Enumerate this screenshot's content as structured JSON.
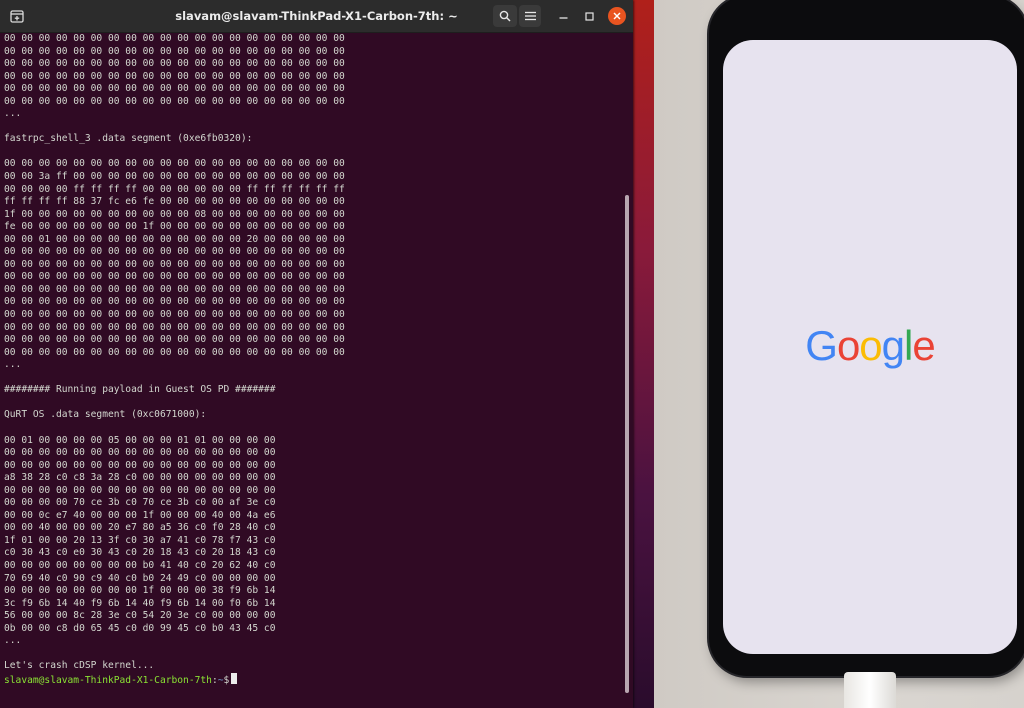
{
  "terminal": {
    "title": "slavam@slavam-ThinkPad-X1-Carbon-7th: ~",
    "lines": [
      "00 00 00 00 00 00 00 00 00 00 00 00 00 00 00 00 00 00 00 00",
      "00 00 00 00 00 00 00 00 00 00 00 00 00 00 00 00 00 00 00 00",
      "00 00 00 00 00 00 00 00 00 00 00 00 00 00 00 00 00 00 00 00",
      "00 00 00 00 00 00 00 00 00 00 00 00 00 00 00 00 00 00 00 00",
      "00 00 00 00 00 00 00 00 00 00 00 00 00 00 00 00 00 00 00 00",
      "00 00 00 00 00 00 00 00 00 00 00 00 00 00 00 00 00 00 00 00",
      "...",
      "",
      "fastrpc_shell_3 .data segment (0xe6fb0320):",
      "",
      "00 00 00 00 00 00 00 00 00 00 00 00 00 00 00 00 00 00 00 00",
      "00 00 3a ff 00 00 00 00 00 00 00 00 00 00 00 00 00 00 00 00",
      "00 00 00 00 ff ff ff ff 00 00 00 00 00 00 ff ff ff ff ff ff",
      "ff ff ff ff 88 37 fc e6 fe 00 00 00 00 00 00 00 00 00 00 00",
      "1f 00 00 00 00 00 00 00 00 00 00 08 00 00 00 00 00 00 00 00",
      "fe 00 00 00 00 00 00 00 1f 00 00 00 00 00 00 00 00 00 00 00",
      "00 00 01 00 00 00 00 00 00 00 00 00 00 00 20 00 00 00 00 00",
      "00 00 00 00 00 00 00 00 00 00 00 00 00 00 00 00 00 00 00 00",
      "00 00 00 00 00 00 00 00 00 00 00 00 00 00 00 00 00 00 00 00",
      "00 00 00 00 00 00 00 00 00 00 00 00 00 00 00 00 00 00 00 00",
      "00 00 00 00 00 00 00 00 00 00 00 00 00 00 00 00 00 00 00 00",
      "00 00 00 00 00 00 00 00 00 00 00 00 00 00 00 00 00 00 00 00",
      "00 00 00 00 00 00 00 00 00 00 00 00 00 00 00 00 00 00 00 00",
      "00 00 00 00 00 00 00 00 00 00 00 00 00 00 00 00 00 00 00 00",
      "00 00 00 00 00 00 00 00 00 00 00 00 00 00 00 00 00 00 00 00",
      "00 00 00 00 00 00 00 00 00 00 00 00 00 00 00 00 00 00 00 00",
      "...",
      "",
      "######## Running payload in Guest OS PD #######",
      "",
      "QuRT OS .data segment (0xc0671000):",
      "",
      "00 01 00 00 00 00 05 00 00 00 01 01 00 00 00 00",
      "00 00 00 00 00 00 00 00 00 00 00 00 00 00 00 00",
      "00 00 00 00 00 00 00 00 00 00 00 00 00 00 00 00",
      "a8 38 28 c0 c8 3a 28 c0 00 00 00 00 00 00 00 00",
      "00 00 00 00 00 00 00 00 00 00 00 00 00 00 00 00",
      "00 00 00 00 70 ce 3b c0 70 ce 3b c0 00 af 3e c0",
      "00 00 0c e7 40 00 00 00 1f 00 00 00 40 00 4a e6",
      "00 00 40 00 00 00 20 e7 80 a5 36 c0 f0 28 40 c0",
      "1f 01 00 00 20 13 3f c0 30 a7 41 c0 78 f7 43 c0",
      "c0 30 43 c0 e0 30 43 c0 20 18 43 c0 20 18 43 c0",
      "00 00 00 00 00 00 00 00 b0 41 40 c0 20 62 40 c0",
      "70 69 40 c0 90 c9 40 c0 b0 24 49 c0 00 00 00 00",
      "00 00 00 00 00 00 00 00 1f 00 00 00 38 f9 6b 14",
      "3c f9 6b 14 40 f9 6b 14 40 f9 6b 14 00 f0 6b 14",
      "56 00 00 00 8c 28 3e c0 54 20 3e c0 00 00 00 00",
      "0b 00 00 c8 d0 65 45 c0 d0 99 45 c0 b0 43 45 c0",
      "...",
      "",
      "Let's crash cDSP kernel..."
    ],
    "prompt_user": "slavam@slavam-ThinkPad-X1-Carbon-7th",
    "prompt_sep": ":",
    "prompt_path": "~",
    "prompt_symbol": "$"
  },
  "phone": {
    "logo": [
      "G",
      "o",
      "o",
      "g",
      "l",
      "e"
    ],
    "logo_colors": [
      "#4285f4",
      "#ea4335",
      "#fbbc05",
      "#4285f4",
      "#34a853",
      "#ea4335"
    ]
  },
  "icons": {
    "new_tab": "new-tab-icon",
    "search": "search-icon",
    "menu": "hamburger-menu-icon",
    "minimize": "minimize-icon",
    "maximize": "maximize-icon",
    "close": "close-icon"
  },
  "colors": {
    "terminal_bg": "#300a24",
    "terminal_fg": "#d3d7cf",
    "prompt_user": "#8ae234",
    "prompt_path": "#729fcf",
    "close_button": "#e95420"
  }
}
